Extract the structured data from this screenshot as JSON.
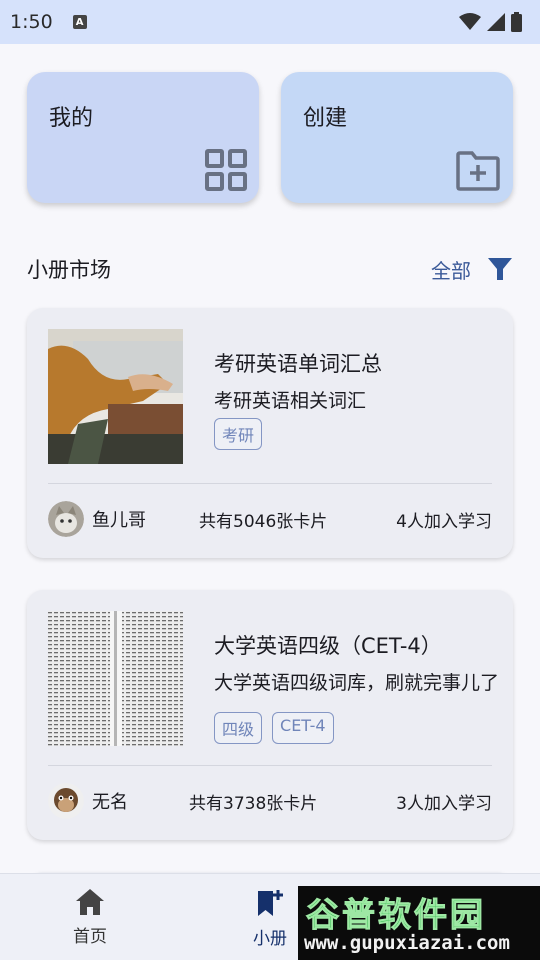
{
  "status_bar": {
    "time": "1:50",
    "a_badge": "A"
  },
  "top_cards": [
    {
      "label": "我的",
      "icon": "grid-icon"
    },
    {
      "label": "创建",
      "icon": "folder-add-icon"
    }
  ],
  "market": {
    "title": "小册市场",
    "filter_label": "全部",
    "filter_icon": "filter-icon"
  },
  "books": [
    {
      "title": "考研英语单词汇总",
      "desc": "考研英语相关词汇",
      "tags": [
        "考研"
      ],
      "author": "鱼儿哥",
      "count": "共有5046张卡片",
      "learners": "4人加入学习"
    },
    {
      "title": "大学英语四级（CET-4）",
      "desc": "大学英语四级词库，刷就完事儿了",
      "tags": [
        "四级",
        "CET-4"
      ],
      "author": "无名",
      "count": "共有3738张卡片",
      "learners": "3人加入学习"
    }
  ],
  "nav": {
    "home": "首页",
    "book": "小册"
  },
  "watermark": {
    "top": "谷普软件园",
    "bottom": "www.gupuxiazai.com"
  },
  "colors": {
    "accent": "#3b5a99",
    "status_bar": "#d6e2fb",
    "card": "#ecedf3"
  }
}
